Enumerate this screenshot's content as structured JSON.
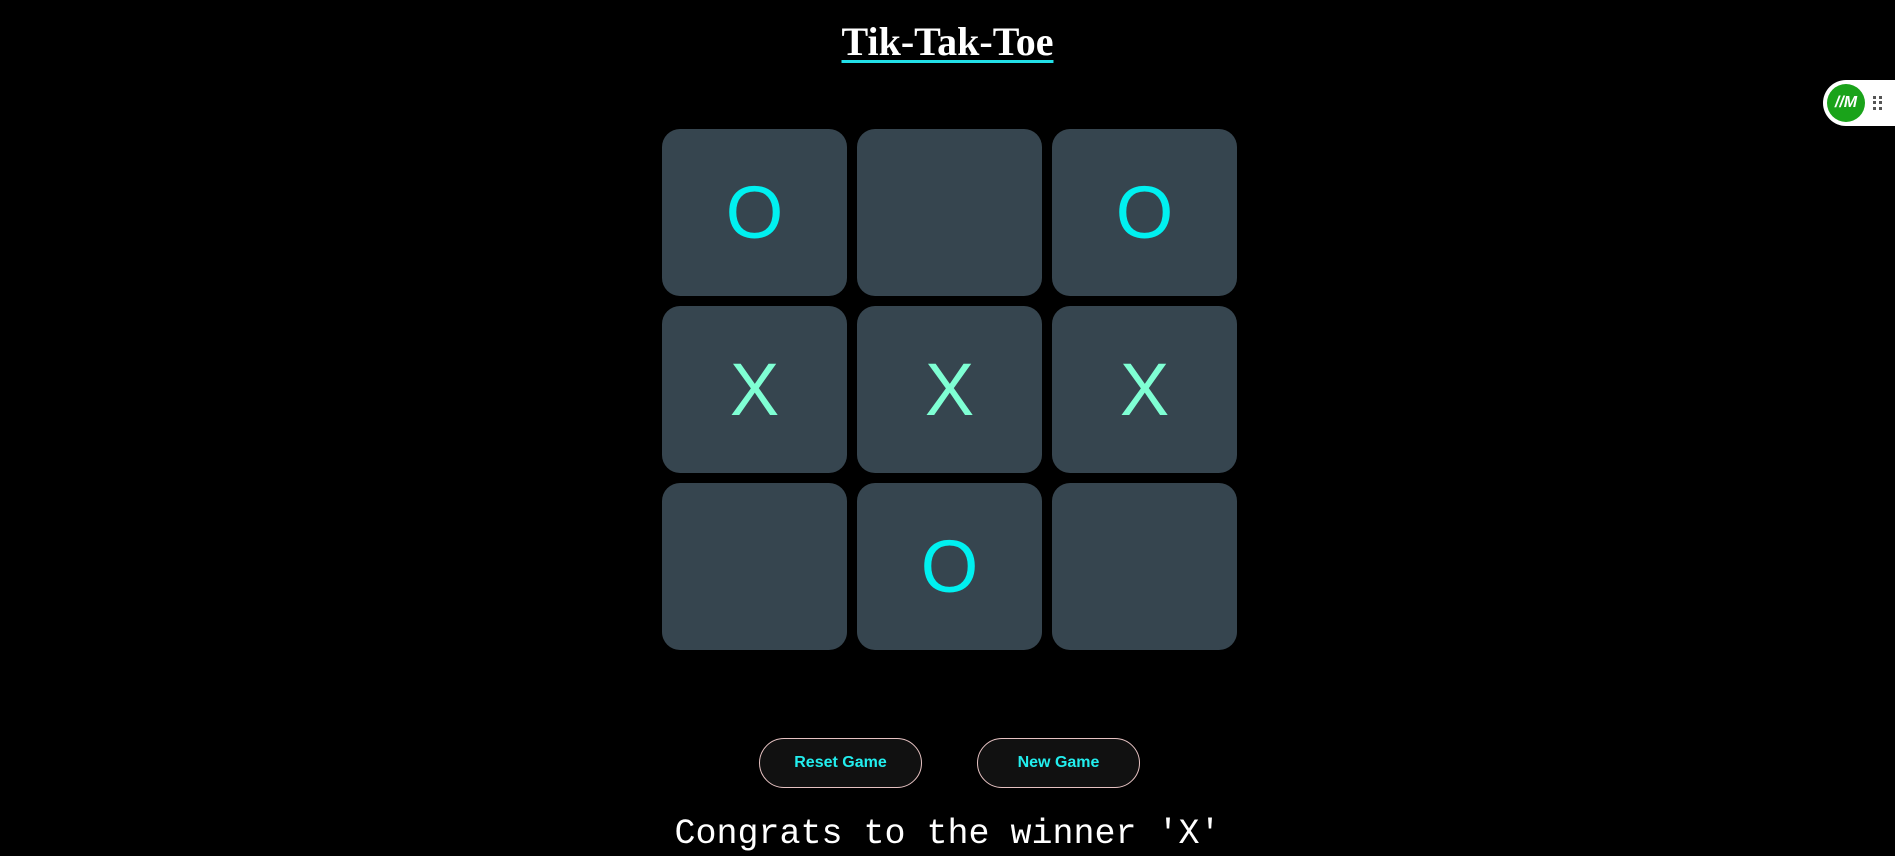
{
  "title": "Tik-Tak-Toe",
  "board": [
    {
      "mark": "O"
    },
    {
      "mark": ""
    },
    {
      "mark": "O"
    },
    {
      "mark": "X"
    },
    {
      "mark": "X"
    },
    {
      "mark": "X"
    },
    {
      "mark": ""
    },
    {
      "mark": "O"
    },
    {
      "mark": ""
    }
  ],
  "buttons": {
    "reset": "Reset Game",
    "new_game": "New Game"
  },
  "message": "Congrats to the winner 'X'",
  "extension": {
    "logo": "//M"
  },
  "colors": {
    "o": "#00f0f0",
    "x": "#7fffd4",
    "cell": "#36454f"
  }
}
